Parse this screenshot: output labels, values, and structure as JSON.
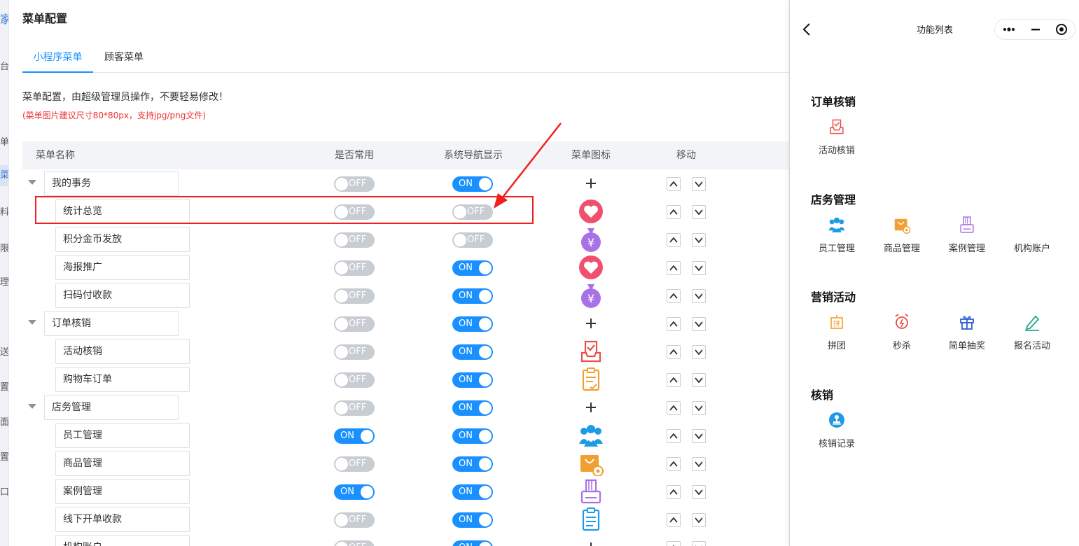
{
  "sidebar_fragments": [
    "家",
    "台",
    "单配",
    "菜",
    "料",
    "限",
    "理",
    "送",
    "置",
    "面",
    "置",
    "口"
  ],
  "page": {
    "title": "菜单配置",
    "tabs": [
      "小程序菜单",
      "顾客菜单"
    ],
    "description": "菜单配置，由超级管理员操作，不要轻易修改！",
    "hint": "(菜单图片建议尺寸80*80px，支持jpg/png文件)"
  },
  "table": {
    "headers": [
      "菜单名称",
      "是否常用",
      "系统导航显示",
      "菜单图标",
      "移动"
    ],
    "rows": [
      {
        "name": "我的事务",
        "level": "parent",
        "common": "OFF",
        "nav": "ON",
        "icon": "plus-icon"
      },
      {
        "name": "统计总览",
        "level": "child",
        "common": "OFF",
        "nav": "OFF",
        "icon": "heart-icon"
      },
      {
        "name": "积分金币发放",
        "level": "child",
        "common": "OFF",
        "nav": "OFF",
        "icon": "money-bag-icon"
      },
      {
        "name": "海报推广",
        "level": "child",
        "common": "OFF",
        "nav": "ON",
        "icon": "heart-icon"
      },
      {
        "name": "扫码付收款",
        "level": "child",
        "common": "OFF",
        "nav": "ON",
        "icon": "money-bag-icon"
      },
      {
        "name": "订单核销",
        "level": "parent",
        "common": "OFF",
        "nav": "ON",
        "icon": "plus-icon"
      },
      {
        "name": "活动核销",
        "level": "child",
        "common": "OFF",
        "nav": "ON",
        "icon": "inbox-check-icon"
      },
      {
        "name": "购物车订单",
        "level": "child",
        "common": "OFF",
        "nav": "ON",
        "icon": "clipboard-icon"
      },
      {
        "name": "店务管理",
        "level": "parent",
        "common": "OFF",
        "nav": "ON",
        "icon": "plus-icon"
      },
      {
        "name": "员工管理",
        "level": "child",
        "common": "ON",
        "nav": "ON",
        "icon": "team-icon"
      },
      {
        "name": "商品管理",
        "level": "child",
        "common": "OFF",
        "nav": "ON",
        "icon": "shopping-bag-icon"
      },
      {
        "name": "案例管理",
        "level": "child",
        "common": "ON",
        "nav": "ON",
        "icon": "printer-icon"
      },
      {
        "name": "线下开单收款",
        "level": "child",
        "common": "OFF",
        "nav": "ON",
        "icon": "receipt-icon"
      },
      {
        "name": "机构账户",
        "level": "child",
        "common": "OFF",
        "nav": "ON",
        "icon": "plus-icon"
      }
    ]
  },
  "colors": {
    "accent": "#1890ff",
    "switch_off": "#c8ccd3",
    "highlight": "#f02020",
    "heart": "#f0506e",
    "bag": "#a971e6",
    "order": "#e9504a",
    "clipboard": "#f0a030",
    "team": "#1e9be6"
  },
  "phone": {
    "title": "功能列表",
    "sections": [
      {
        "title": "订单核销",
        "items": [
          {
            "label": "活动核销",
            "icon": "inbox-check-icon"
          }
        ]
      },
      {
        "title": "店务管理",
        "items": [
          {
            "label": "员工管理",
            "icon": "team-icon"
          },
          {
            "label": "商品管理",
            "icon": "shopping-bag-icon"
          },
          {
            "label": "案例管理",
            "icon": "printer-icon"
          },
          {
            "label": "机构账户",
            "icon": "blank"
          }
        ]
      },
      {
        "title": "营销活动",
        "items": [
          {
            "label": "拼团",
            "icon": "group-buy-icon"
          },
          {
            "label": "秒杀",
            "icon": "alarm-clock-icon"
          },
          {
            "label": "简单抽奖",
            "icon": "gift-icon"
          },
          {
            "label": "报名活动",
            "icon": "pencil-icon"
          }
        ]
      },
      {
        "title": "核销",
        "items": [
          {
            "label": "核销记录",
            "icon": "stamp-icon"
          }
        ]
      }
    ]
  }
}
